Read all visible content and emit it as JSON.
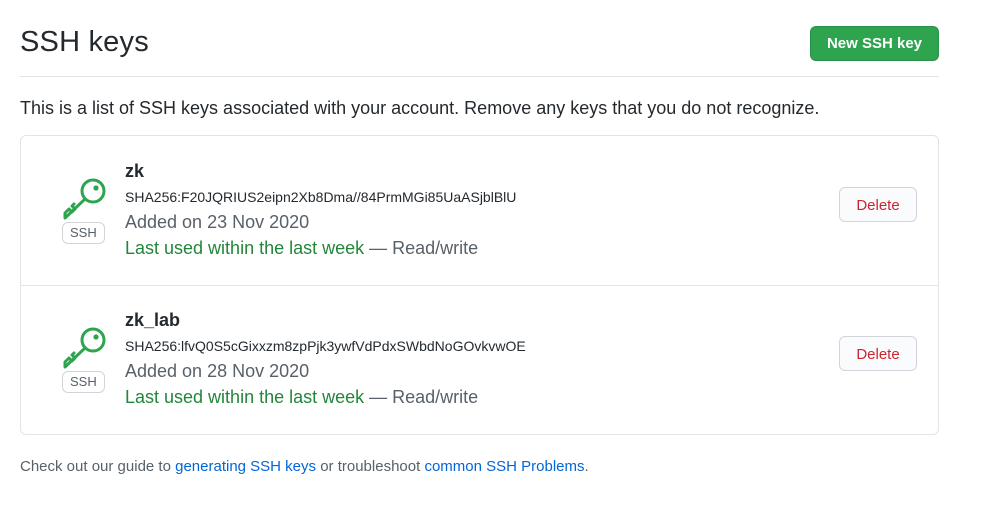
{
  "page": {
    "title": "SSH keys",
    "new_button_label": "New SSH key",
    "intro": "This is a list of SSH keys associated with your account. Remove any keys that you do not recognize."
  },
  "keys": [
    {
      "name": "zk",
      "fingerprint": "SHA256:F20JQRIUS2eipn2Xb8Dma//84PrmMGi85UaASjblBlU",
      "added": "Added on 23 Nov 2020",
      "last_used": "Last used within the last week",
      "access": " — Read/write",
      "badge": "SSH",
      "delete_label": "Delete",
      "icon": "key-icon"
    },
    {
      "name": "zk_lab",
      "fingerprint": "SHA256:lfvQ0S5cGixxzm8zpPjk3ywfVdPdxSWbdNoGOvkvwOE",
      "added": "Added on 28 Nov 2020",
      "last_used": "Last used within the last week",
      "access": " — Read/write",
      "badge": "SSH",
      "delete_label": "Delete",
      "icon": "key-icon"
    }
  ],
  "footer": {
    "prefix": "Check out our guide to ",
    "link1": "generating SSH keys",
    "middle": " or troubleshoot ",
    "link2": "common SSH Problems",
    "suffix": "."
  },
  "colors": {
    "primary_button": "#2ea44f",
    "danger": "#cb2431",
    "success_text": "#22863a",
    "link": "#0366d6"
  }
}
